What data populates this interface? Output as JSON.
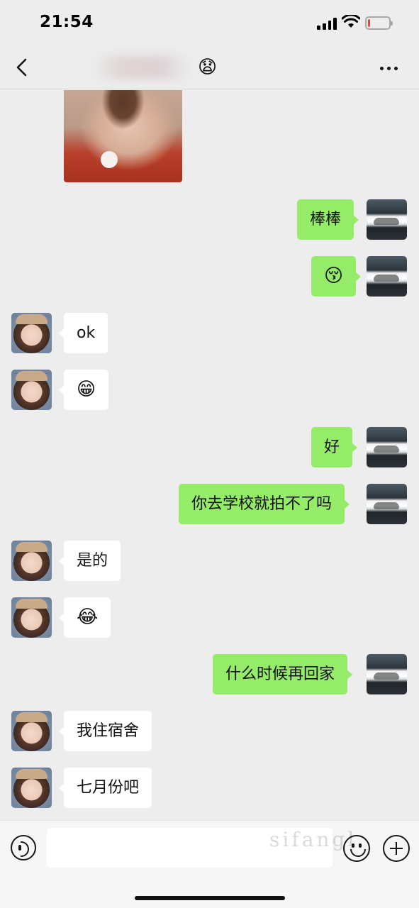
{
  "status_bar": {
    "time": "21:54",
    "battery_level_fraction": 0.12,
    "battery_color": "#f2443a"
  },
  "nav": {
    "title_emoji": "😧",
    "back_icon": "chevron-left-icon",
    "more_icon": "ellipsis-icon"
  },
  "messages": [
    {
      "side": "in",
      "type": "image",
      "sender": "contact"
    },
    {
      "side": "out",
      "type": "text",
      "text": "棒棒"
    },
    {
      "side": "out",
      "type": "emoji",
      "text": "😚"
    },
    {
      "side": "in",
      "type": "text",
      "text": "ok"
    },
    {
      "side": "in",
      "type": "emoji",
      "text": "😁"
    },
    {
      "side": "out",
      "type": "text",
      "text": "好"
    },
    {
      "side": "out",
      "type": "text",
      "text": "你去学校就拍不了吗"
    },
    {
      "side": "in",
      "type": "text",
      "text": "是的"
    },
    {
      "side": "in",
      "type": "emoji",
      "text": "😂"
    },
    {
      "side": "out",
      "type": "text",
      "text": "什么时候再回家"
    },
    {
      "side": "in",
      "type": "text",
      "text": "我住宿舍"
    },
    {
      "side": "in",
      "type": "text",
      "text": "七月份吧"
    }
  ],
  "input_bar": {
    "value": "",
    "watermark": "sifangl",
    "icons": [
      "voice-icon",
      "emoji-icon",
      "plus-icon"
    ]
  },
  "colors": {
    "background": "#ededed",
    "outgoing_bubble": "#95ec69",
    "incoming_bubble": "#ffffff"
  }
}
